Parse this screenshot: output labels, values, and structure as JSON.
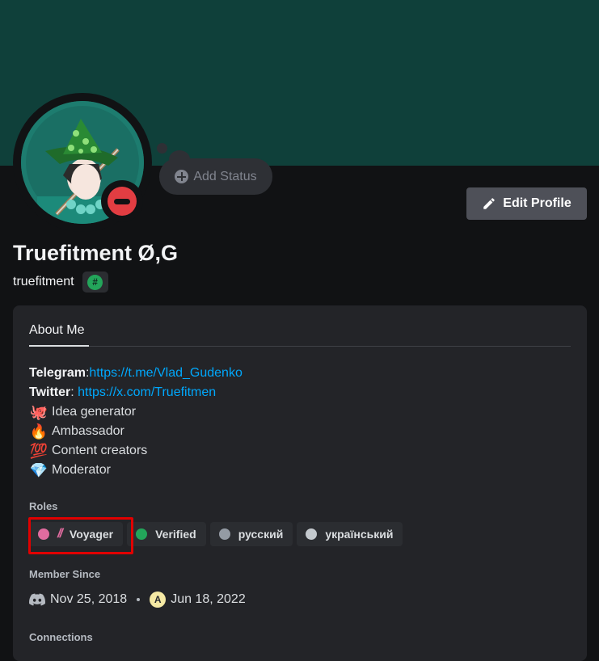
{
  "profile": {
    "display_name": "Truefitment Ø,G",
    "username": "truefitment",
    "tag_symbol": "#",
    "add_status_label": "Add Status",
    "edit_profile_label": "Edit Profile"
  },
  "tabs": {
    "about_me": "About Me"
  },
  "bio": {
    "telegram_label": "Telegram",
    "telegram_sep": ":",
    "telegram_url": "https://t.me/Vlad_Gudenko",
    "twitter_label": "Twitter",
    "twitter_sep": ": ",
    "twitter_url": "https://x.com/Truefitmen",
    "lines": [
      {
        "emoji": "🐙",
        "text": "Idea generator"
      },
      {
        "emoji": "🔥",
        "text": "Ambassador"
      },
      {
        "emoji": "💯",
        "text": "Content creators"
      },
      {
        "emoji": "💎",
        "text": "Moderator"
      }
    ]
  },
  "sections": {
    "roles_title": "Roles",
    "member_since_title": "Member Since",
    "connections_title": "Connections"
  },
  "roles": [
    {
      "name": "Voyager",
      "color": "#e06c9f",
      "icon": "//"
    },
    {
      "name": "Verified",
      "color": "#23a55a"
    },
    {
      "name": "русский",
      "color": "#949ba4"
    },
    {
      "name": "український",
      "color": "#c4c9ce"
    }
  ],
  "member_since": {
    "discord_date": "Nov 25, 2018",
    "server_initial": "A",
    "server_date": "Jun 18, 2022"
  },
  "colors": {
    "banner": "#0f403a",
    "status_dnd": "#e23d42",
    "link": "#00a8fc",
    "highlight": "#e10000"
  }
}
